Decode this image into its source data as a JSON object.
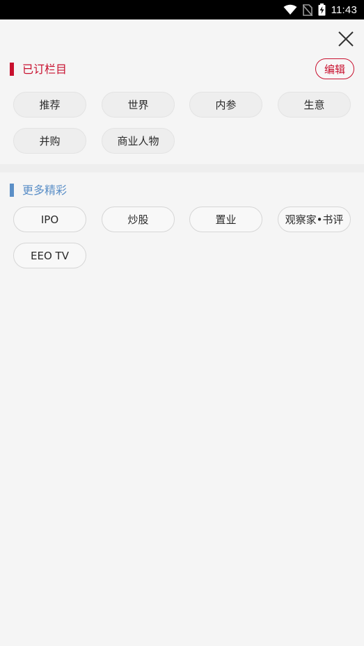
{
  "status_bar": {
    "time": "11:43",
    "icons": [
      "wifi-icon",
      "no-sim-icon",
      "battery-charging-icon"
    ]
  },
  "close_icon": "close-icon",
  "subscribed": {
    "title": "已订栏目",
    "edit_label": "编辑",
    "accent": "#c8102e",
    "items": [
      "推荐",
      "世界",
      "内参",
      "生意",
      "并购",
      "商业人物"
    ]
  },
  "more": {
    "title": "更多精彩",
    "accent": "#5b8fc7",
    "items": [
      "IPO",
      "炒股",
      "置业",
      "观察家•书评",
      "EEO TV"
    ]
  }
}
